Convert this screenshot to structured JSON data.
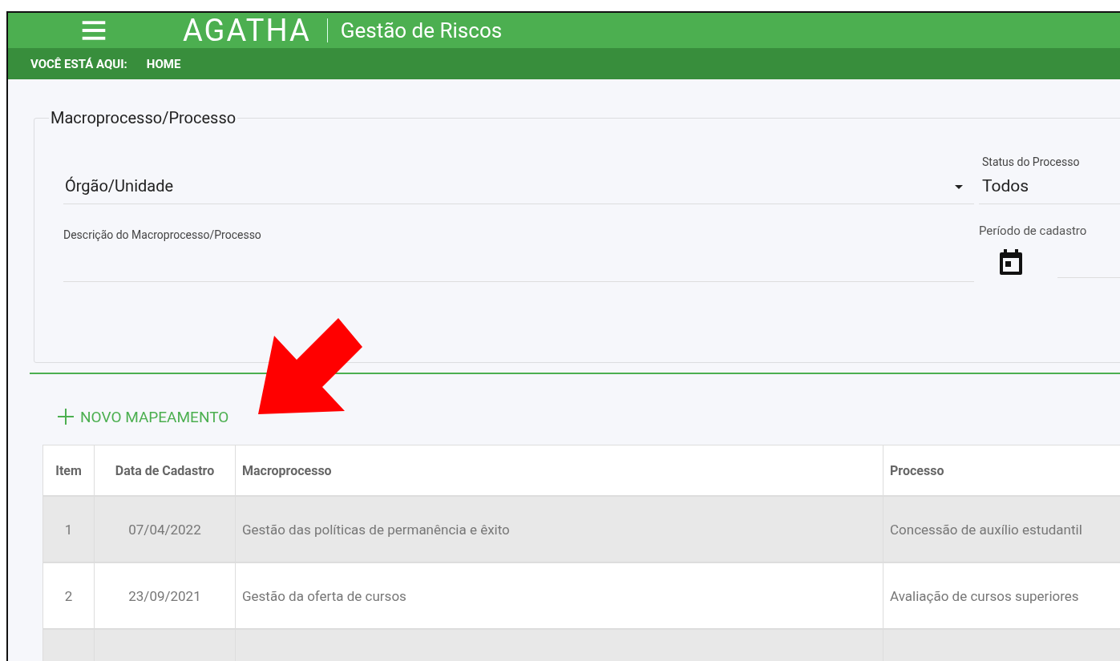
{
  "header": {
    "logo": "AGATHA",
    "subtitle": "Gestão de Riscos"
  },
  "breadcrumb": {
    "label": "VOCÊ ESTÁ AQUI:",
    "items": [
      "HOME"
    ]
  },
  "filters": {
    "legend": "Macroprocesso/Processo",
    "unit_select": {
      "value": "Órgão/Unidade"
    },
    "status": {
      "label": "Status do Processo",
      "value": "Todos"
    },
    "description": {
      "label": "Descrição do Macroprocesso/Processo"
    },
    "period": {
      "label": "Período de cadastro"
    }
  },
  "new_button": {
    "label": "NOVO MAPEAMENTO"
  },
  "table": {
    "columns": [
      "Item",
      "Data de Cadastro",
      "Macroprocesso",
      "Processo"
    ],
    "rows": [
      {
        "cells": [
          "1",
          "07/04/2022",
          "Gestão das políticas de permanência e êxito",
          "Concessão de auxílio estudantil"
        ]
      },
      {
        "cells": [
          "2",
          "23/09/2021",
          "Gestão da oferta de cursos",
          "Avaliação de cursos superiores"
        ]
      }
    ]
  }
}
